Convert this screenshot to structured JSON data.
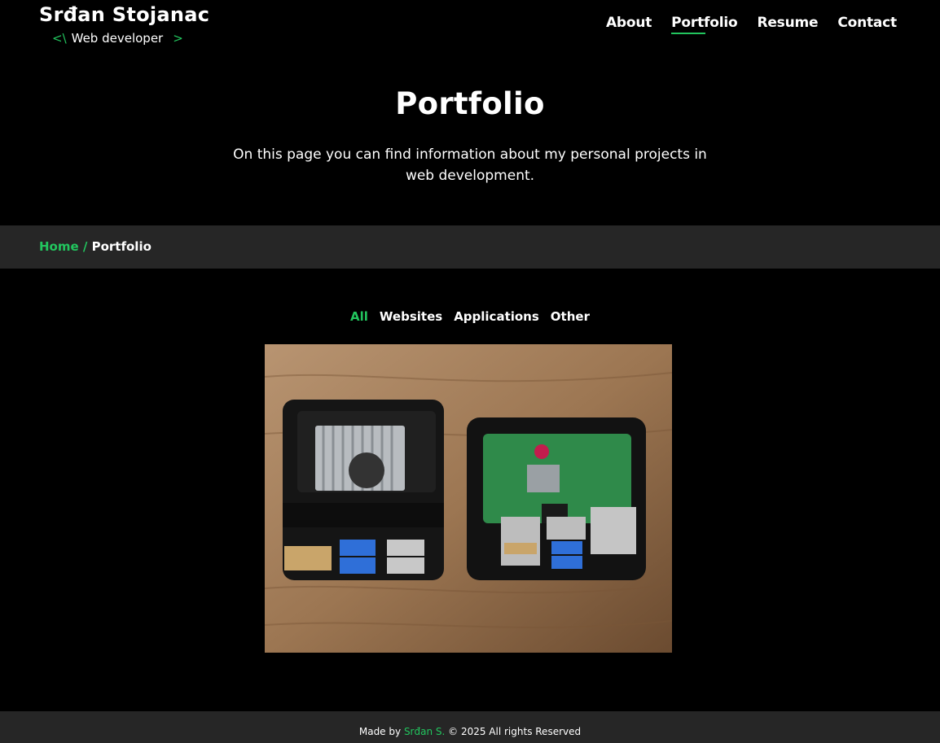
{
  "header": {
    "name": "Srđan Stojanac",
    "subtitle_open": "<\\",
    "subtitle": "Web developer",
    "subtitle_close": ">"
  },
  "nav": {
    "about": "About",
    "portfolio": "Portfolio",
    "resume": "Resume",
    "contact": "Contact"
  },
  "hero": {
    "title": "Portfolio",
    "description": "On this page you can find information about my personal projects in web development."
  },
  "breadcrumb": {
    "home": "Home",
    "separator": " / ",
    "current": "Portfolio"
  },
  "filters": {
    "all": "All",
    "websites": "Websites",
    "applications": "Applications",
    "other": "Other"
  },
  "footer": {
    "made_by": "Made by",
    "author": "Srđan S.",
    "rights": "© 2025 All rights Reserved"
  },
  "colors": {
    "accent": "#22c55e",
    "background": "#000000",
    "bar": "#262626"
  }
}
